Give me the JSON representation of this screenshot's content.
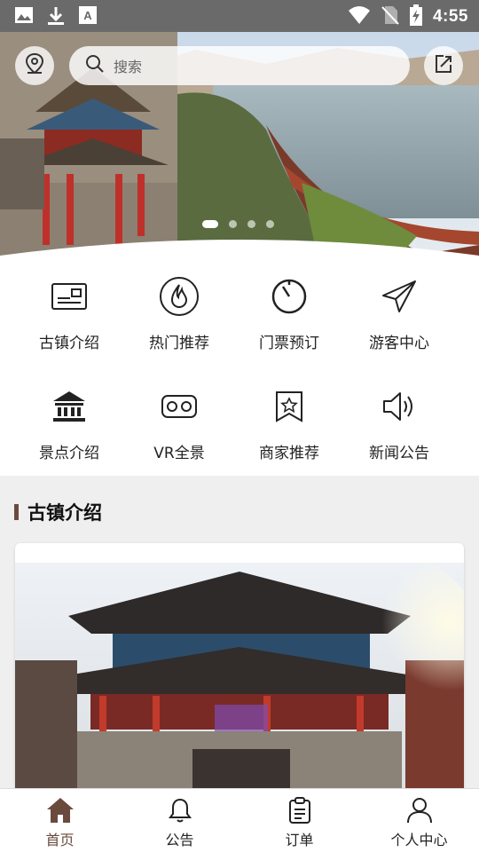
{
  "status_bar": {
    "time": "4:55",
    "left_icons": [
      "image-icon",
      "download-icon",
      "text-icon"
    ],
    "right_icons": [
      "wifi-icon",
      "no-sim-icon",
      "battery-charging-icon"
    ]
  },
  "search": {
    "placeholder": "搜索"
  },
  "banner": {
    "slide_count": 4,
    "active_slide": 1
  },
  "menu": {
    "items": [
      {
        "label": "古镇介绍",
        "icon": "id-card-icon"
      },
      {
        "label": "热门推荐",
        "icon": "fire-icon"
      },
      {
        "label": "门票预订",
        "icon": "timer-icon"
      },
      {
        "label": "游客中心",
        "icon": "paper-plane-icon"
      },
      {
        "label": "景点介绍",
        "icon": "temple-icon"
      },
      {
        "label": "VR全景",
        "icon": "vr-headset-icon"
      },
      {
        "label": "商家推荐",
        "icon": "star-badge-icon"
      },
      {
        "label": "新闻公告",
        "icon": "speaker-icon"
      }
    ]
  },
  "section": {
    "title": "古镇介绍"
  },
  "bottom_nav": {
    "items": [
      {
        "label": "首页",
        "icon": "home-icon",
        "active": true
      },
      {
        "label": "公告",
        "icon": "bell-icon",
        "active": false
      },
      {
        "label": "订单",
        "icon": "clipboard-icon",
        "active": false
      },
      {
        "label": "个人中心",
        "icon": "person-icon",
        "active": false
      }
    ]
  },
  "colors": {
    "accent": "#6b4a3e",
    "status_bar": "#6a6a6a"
  }
}
